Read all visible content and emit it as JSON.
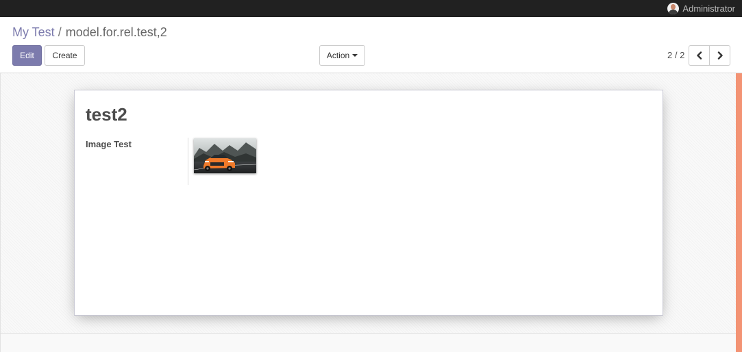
{
  "topbar": {
    "user_name": "Administrator"
  },
  "breadcrumb": {
    "parent": "My Test",
    "separator": "/",
    "current": "model.for.rel.test,2"
  },
  "buttons": {
    "edit": "Edit",
    "create": "Create",
    "action": "Action"
  },
  "pager": {
    "value": "2 / 2"
  },
  "record": {
    "title": "test2",
    "fields": [
      {
        "label": "Image Test"
      }
    ]
  },
  "colors": {
    "brand": "#7c7bad",
    "accent": "#f39374",
    "topbar": "#212121"
  },
  "icons": {
    "user": "avatar",
    "prev": "chevron-left-icon",
    "next": "chevron-right-icon",
    "dropdown": "caret-down-icon"
  }
}
